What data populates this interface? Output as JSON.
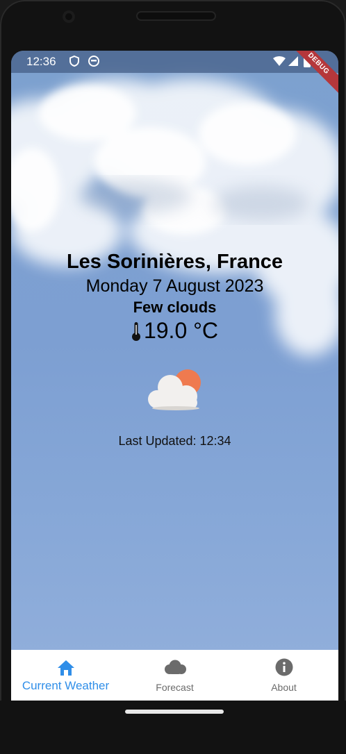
{
  "status_bar": {
    "time": "12:36",
    "debug_label": "DEBUG"
  },
  "weather": {
    "location": "Les Sorinières, France",
    "date": "Monday 7 August 2023",
    "description": "Few clouds",
    "temperature": "19.0 °C",
    "last_updated_label": "Last Updated: 12:34",
    "condition_icon": "few-clouds-icon"
  },
  "nav": {
    "items": [
      {
        "label": "Current Weather",
        "icon": "home-icon",
        "active": true
      },
      {
        "label": "Forecast",
        "icon": "cloud-icon",
        "active": false
      },
      {
        "label": "About",
        "icon": "info-icon",
        "active": false
      }
    ],
    "active_color": "#2f8ee8",
    "inactive_color": "#6b6b6b"
  },
  "colors": {
    "sky": "#7da1cf",
    "sun": "#ef7a4f",
    "cloud": "#f2f0ee"
  }
}
